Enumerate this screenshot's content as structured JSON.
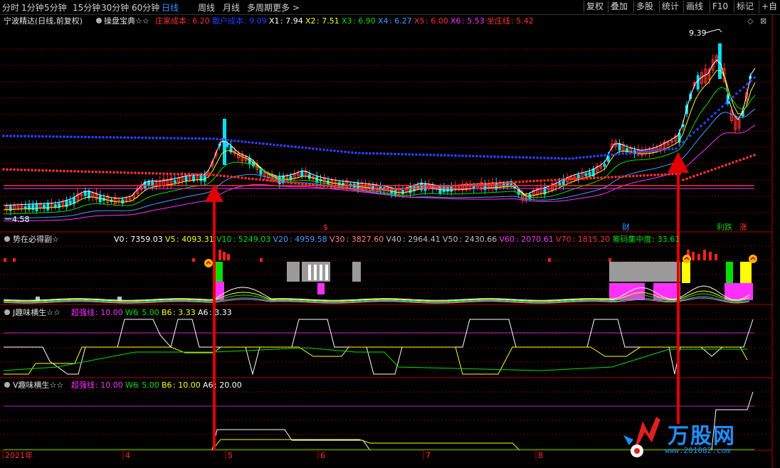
{
  "toolbar": {
    "periods": [
      "分时",
      "1分钟",
      "5分钟",
      "15分钟",
      "30分钟",
      "60分钟",
      "日线",
      "周线",
      "月线",
      "多周期",
      "更多 >"
    ],
    "active_period": "日线",
    "right_buttons": [
      "复权",
      "叠加",
      "多股",
      "统计",
      "画线",
      "F10",
      "标记",
      "+自"
    ]
  },
  "main_panel": {
    "stock_title": "宁波精达(日线,前复权)",
    "indicator_name": "操盘宝典☆☆",
    "legend": [
      {
        "label": "庄家成本",
        "value": "6.20",
        "color": "#ff3030"
      },
      {
        "label": "散户成本",
        "value": "9.09",
        "color": "#2040ff"
      },
      {
        "label": "X1",
        "value": "7.94",
        "color": "#ffffff"
      },
      {
        "label": "X2",
        "value": "7.51",
        "color": "#ffff00"
      },
      {
        "label": "X3",
        "value": "6.90",
        "color": "#00e000"
      },
      {
        "label": "X4",
        "value": "6.27",
        "color": "#40a0ff"
      },
      {
        "label": "X5",
        "value": "6.00",
        "color": "#ff3030"
      },
      {
        "label": "X6",
        "value": "5.53",
        "color": "#ff30ff"
      },
      {
        "label": "坐庄线",
        "value": "5.42",
        "color": "#ff3030"
      }
    ],
    "high_label": "9.39",
    "low_label": "4.58",
    "markers": [
      {
        "text": "$",
        "color": "#ff3030"
      },
      {
        "text": "财",
        "color": "#3c8cff"
      },
      {
        "text": "利跌",
        "color": "#00d000"
      },
      {
        "text": "涨",
        "color": "#ff3030"
      }
    ]
  },
  "panel2": {
    "indicator_name": "势在必得副☆",
    "legend": [
      {
        "label": "V0",
        "value": "7359.03",
        "color": "#ffffff"
      },
      {
        "label": "V5",
        "value": "4093.31",
        "color": "#ffff00"
      },
      {
        "label": "V10",
        "value": "5249.03",
        "color": "#00e000"
      },
      {
        "label": "V20",
        "value": "4959.58",
        "color": "#40a0ff"
      },
      {
        "label": "V30",
        "value": "3827.60",
        "color": "#ff8080"
      },
      {
        "label": "V40",
        "value": "2964.41",
        "color": "#c0c0c0"
      },
      {
        "label": "V50",
        "value": "2430.66",
        "color": "#c0c0c0"
      },
      {
        "label": "V60",
        "value": "2070.61",
        "color": "#ff30ff"
      },
      {
        "label": "V70",
        "value": "1815.20",
        "color": "#ff3030"
      },
      {
        "label": "筹码集中度",
        "value": "33.61",
        "color": "#00e000"
      }
    ]
  },
  "panel3": {
    "indicator_name": "J趣味横生☆☆",
    "legend": [
      {
        "label": "超强线",
        "value": "10.00",
        "color": "#ff30ff"
      },
      {
        "label": "W6",
        "value": "5.00",
        "color": "#00e000"
      },
      {
        "label": "B6",
        "value": "3.33",
        "color": "#ffff00"
      },
      {
        "label": "A6",
        "value": "3.33",
        "color": "#ffffff"
      }
    ]
  },
  "panel4": {
    "indicator_name": "V趣味横生☆☆",
    "legend": [
      {
        "label": "超强线",
        "value": "10.00",
        "color": "#ff30ff"
      },
      {
        "label": "W6",
        "value": "5.00",
        "color": "#00e000"
      },
      {
        "label": "B6",
        "value": "10.00",
        "color": "#ffff00"
      },
      {
        "label": "A6",
        "value": "20.00",
        "color": "#ffffff"
      }
    ]
  },
  "x_axis": [
    "2021年",
    "4",
    "5",
    "6",
    "7",
    "8"
  ],
  "watermark": {
    "brand": "万股网",
    "url": "www.201082.com"
  },
  "colors": {
    "up": "#ff3030",
    "down": "#00e0ff",
    "grid": "#7a0000",
    "arrow": "#e00000"
  }
}
